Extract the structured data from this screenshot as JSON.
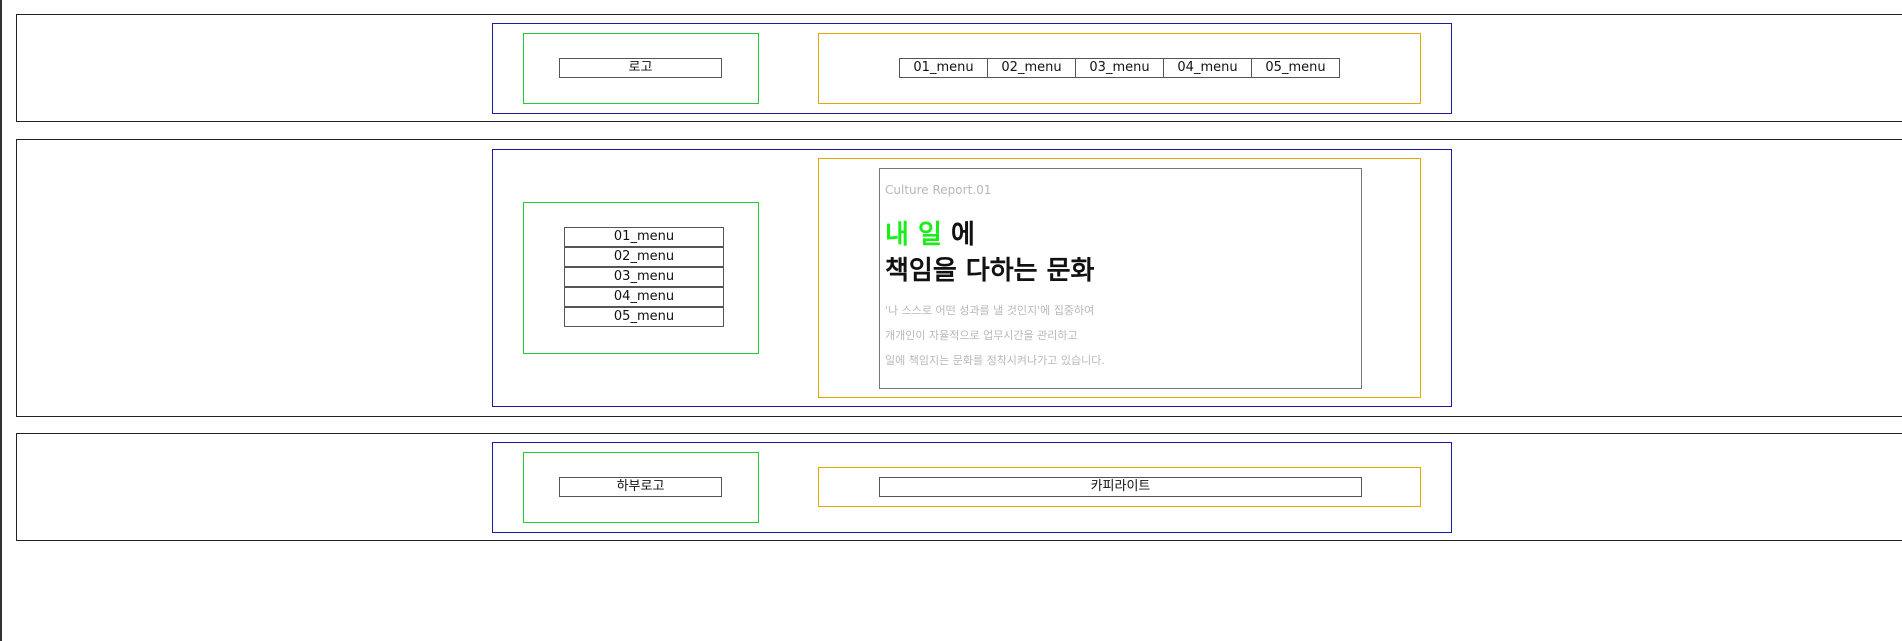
{
  "header": {
    "logo_label": "로고",
    "nav": [
      "01_menu",
      "02_menu",
      "03_menu",
      "04_menu",
      "05_menu"
    ]
  },
  "main": {
    "side_nav": [
      "01_menu",
      "02_menu",
      "03_menu",
      "04_menu",
      "05_menu"
    ],
    "eyebrow": "Culture Report.01",
    "headline_accent": "내 일",
    "headline_rest": "에",
    "headline_line2": "책임을 다하는 문화",
    "description": [
      "'나 스스로 어떤 성과를 낼 것인지'에 집중하여",
      "개개인이 자율적으로 업무시간을 관리하고",
      "일에 책임지는 문화를 정착시켜나가고 있습니다."
    ]
  },
  "footer": {
    "logo_label": "하부로고",
    "copyright": "카피라이트"
  },
  "colors": {
    "wrapper_border": "#1a1aa0",
    "logo_box_border": "#22cc33",
    "content_box_border": "#e0a800",
    "headline_accent": "#1aee1a",
    "muted_text": "#b8b8b8"
  }
}
